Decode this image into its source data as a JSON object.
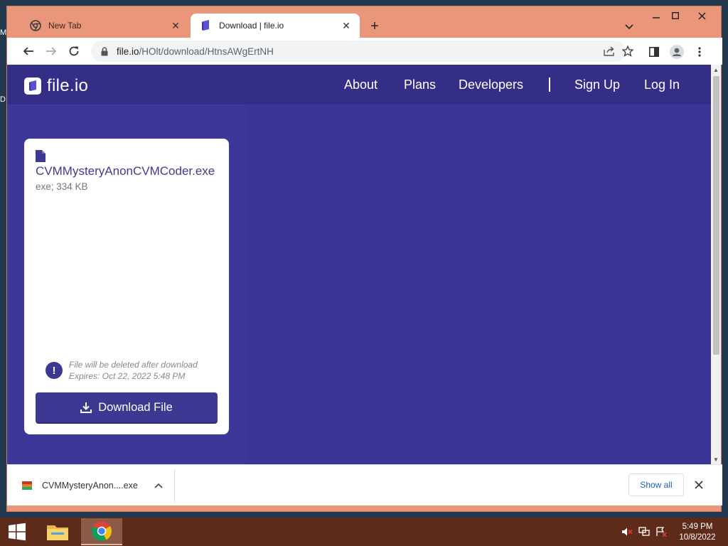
{
  "desktop": {
    "edge_letters": [
      "M",
      "D"
    ]
  },
  "browser": {
    "tabs": [
      {
        "title": "New Tab",
        "active": false
      },
      {
        "title": "Download | file.io",
        "active": true
      }
    ],
    "url": {
      "host": "file.io",
      "path": "/HOlt/download/HtnsAWgErtNH"
    }
  },
  "site": {
    "logo_text": "file.io",
    "nav": {
      "about": "About",
      "plans": "Plans",
      "developers": "Developers",
      "sign_up": "Sign Up",
      "log_in": "Log In"
    },
    "file_card": {
      "file_name": "CVMMysteryAnonCVMCoder.exe",
      "meta": "exe; 334 KB",
      "notice_line1": "File will be deleted after download",
      "notice_line2": "Expires: Oct 22, 2022 5:48 PM",
      "download_label": "Download File"
    },
    "colors": {
      "page_bg": "#3e379a",
      "header_bg": "#342e86",
      "accent": "#3d3892"
    }
  },
  "download_shelf": {
    "item_name": "CVMMysteryAnon....exe",
    "show_all": "Show all"
  },
  "taskbar": {
    "time": "5:49 PM",
    "date": "10/8/2022"
  }
}
